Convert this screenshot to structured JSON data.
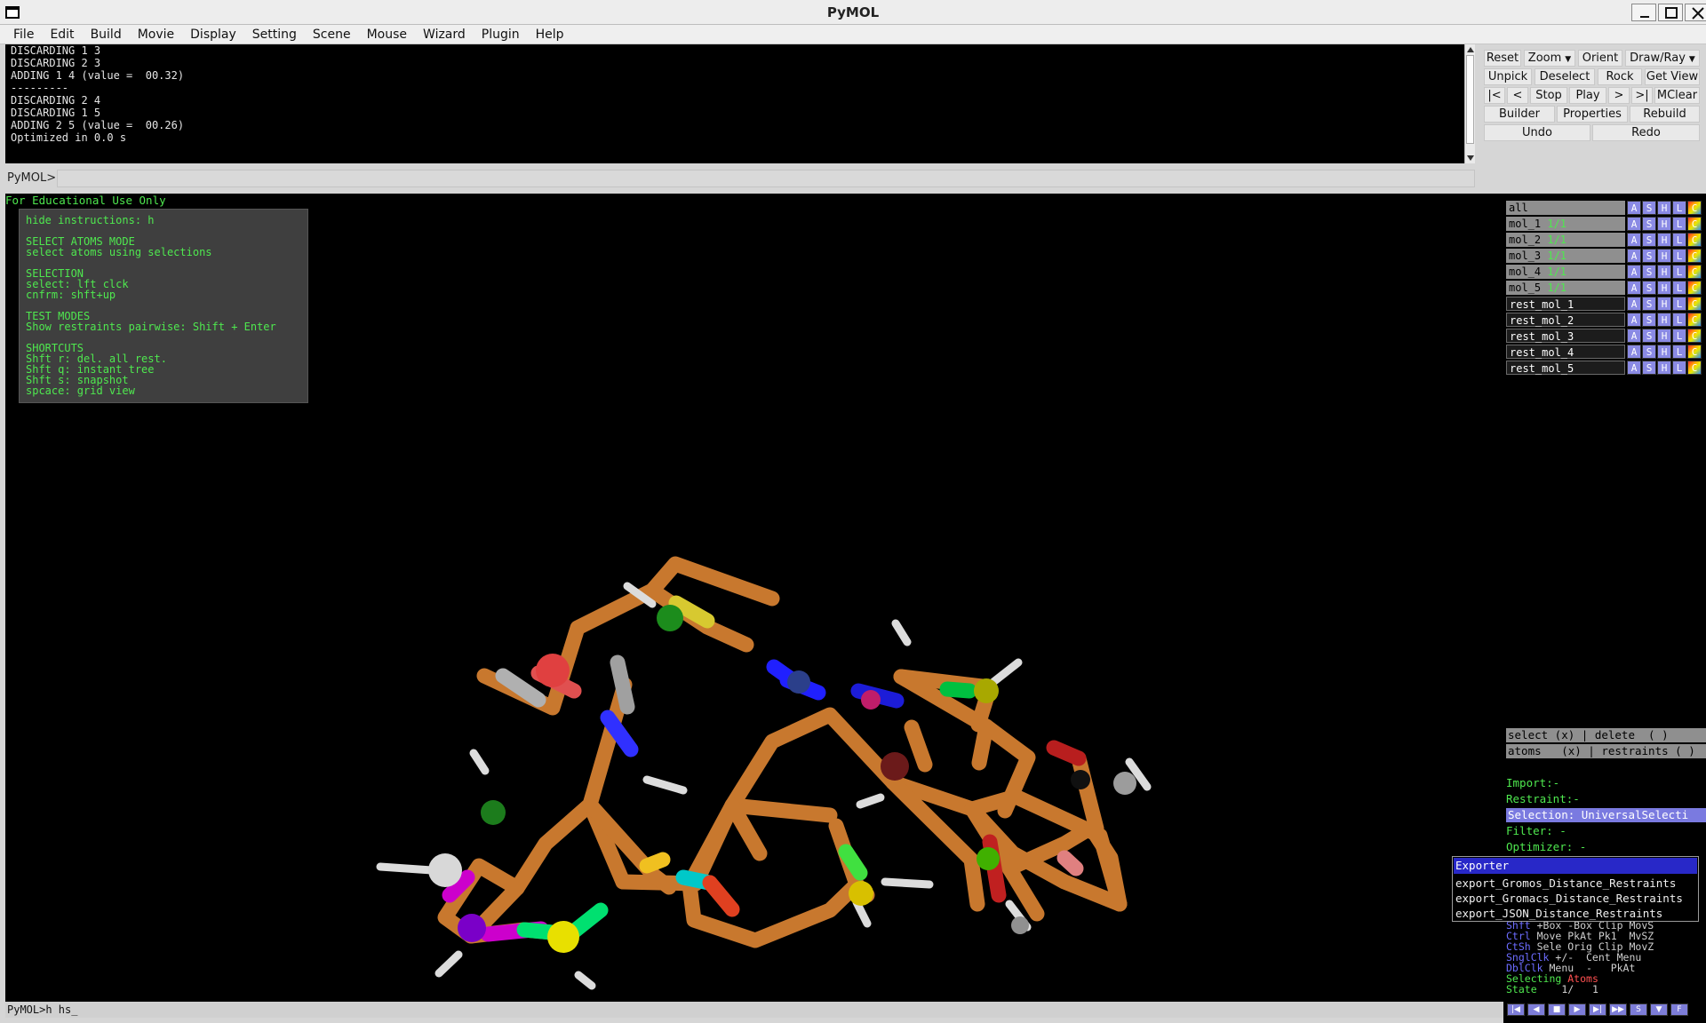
{
  "window": {
    "title": "PyMOL"
  },
  "menu": [
    "File",
    "Edit",
    "Build",
    "Movie",
    "Display",
    "Setting",
    "Scene",
    "Mouse",
    "Wizard",
    "Plugin",
    "Help"
  ],
  "console": {
    "lines": [
      "DISCARDING 1 3",
      "DISCARDING 2 3",
      "ADDING 1 4 (value =  00.32)",
      "---------",
      "DISCARDING 2 4",
      "DISCARDING 1 5",
      "ADDING 2 5 (value =  00.26)",
      "Optimized in 0.0 s"
    ]
  },
  "command": {
    "prompt": "PyMOL>",
    "value": ""
  },
  "buttons": {
    "row1": [
      "Reset",
      "Zoom",
      "Orient",
      "Draw/Ray"
    ],
    "row2": [
      "Unpick",
      "Deselect",
      "Rock",
      "Get View"
    ],
    "row3": [
      "|<",
      "<",
      "Stop",
      "Play",
      ">",
      ">|",
      "MClear"
    ],
    "row4": [
      "Builder",
      "Properties",
      "Rebuild"
    ],
    "row5": [
      "Undo",
      "Redo"
    ]
  },
  "viewer": {
    "banner": "For Educational Use Only",
    "instructions": [
      "hide instructions: h",
      "",
      "SELECT ATOMS MODE",
      "select atoms using selections",
      "",
      "SELECTION",
      "select: lft clck",
      "cnfrm: shft+up",
      "",
      "TEST MODES",
      "Show restraints pairwise: Shift + Enter",
      "",
      "SHORTCUTS",
      "Shft r: del. all rest.",
      "Shft q: instant tree",
      "Shft s: snapshot",
      "spcace: grid view"
    ]
  },
  "objects": [
    {
      "name": "all",
      "state": "",
      "active": true
    },
    {
      "name": "mol_1",
      "state": "1/1",
      "active": true
    },
    {
      "name": "mol_2",
      "state": "1/1",
      "active": true
    },
    {
      "name": "mol_3",
      "state": "1/1",
      "active": true
    },
    {
      "name": "mol_4",
      "state": "1/1",
      "active": true
    },
    {
      "name": "mol_5",
      "state": "1/1",
      "active": true
    },
    {
      "name": "rest_mol_1",
      "state": "",
      "active": false
    },
    {
      "name": "rest_mol_2",
      "state": "",
      "active": false
    },
    {
      "name": "rest_mol_3",
      "state": "",
      "active": false
    },
    {
      "name": "rest_mol_4",
      "state": "",
      "active": false
    },
    {
      "name": "rest_mol_5",
      "state": "",
      "active": false
    }
  ],
  "object_buttons": [
    "A",
    "S",
    "H",
    "L",
    "C"
  ],
  "wizard": {
    "row1": "select (x) | delete  ( )",
    "row2": "atoms   (x) | restraints ( )",
    "import": "Import:-",
    "restraint": "Restraint:-",
    "selection": "Selection: UniversalSelecti",
    "filter": "Filter: -",
    "optimizer": "Optimizer: -"
  },
  "exporter": {
    "title": "Exporter",
    "items": [
      "export_Gromos_Distance_Restraints",
      "export_Gromacs_Distance_Restraints",
      "export_JSON_Distance_Restraints"
    ]
  },
  "mouse_help": {
    "line1k": "Shft",
    "line1": " +Box -Box Clip MovS",
    "line2k": "Ctrl",
    "line2": " Move PkAt Pk1  MvSZ",
    "line3k": "CtSh",
    "line3": " Sele Orig Clip MovZ",
    "line4k": "SnglClk",
    "line4": " +/-  Cent Menu",
    "line5k": "DblClk",
    "line5": " Menu  -   PkAt",
    "selecting_label": "Selecting",
    "selecting_value": "Atoms",
    "state_label": "State",
    "state_value": "1/   1"
  },
  "bottom_command": "PyMOL>h hs_",
  "colors": {
    "console_bg": "#000000",
    "green_text": "#4fe84f",
    "stick": "#c8782e",
    "highlight": "#7a7ae0"
  }
}
